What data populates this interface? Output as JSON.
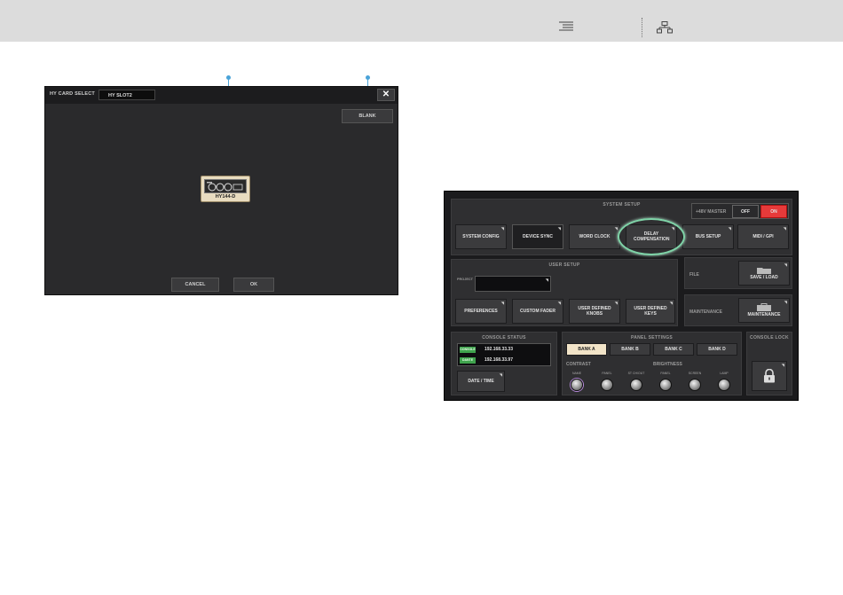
{
  "hy_dialog": {
    "title": "HY CARD SELECT",
    "slot_label": "HY SLOT2",
    "slot_prefix": "HY",
    "blank_button": "BLANK",
    "card_name": "HY144-D",
    "cancel_button": "CANCEL",
    "ok_button": "OK"
  },
  "system_setup": {
    "header": "SYSTEM SETUP",
    "phantom_master": "+48V MASTER",
    "off_label": "OFF",
    "on_label": "ON",
    "buttons": [
      "SYSTEM CONFIG",
      "DEVICE SYNC",
      "WORD CLOCK",
      "DELAY COMPENSATION",
      "BUS SETUP",
      "MIDI / GPI"
    ]
  },
  "user_setup": {
    "header": "USER SETUP",
    "project_label": "PROJECT",
    "buttons": [
      "PREFERENCES",
      "CUSTOM FADER",
      "USER DEFINED KNOBS",
      "USER DEFINED KEYS"
    ]
  },
  "file": {
    "label": "FILE",
    "button": "SAVE / LOAD"
  },
  "maintenance": {
    "label": "MAINTENANCE",
    "button": "MAINTENANCE"
  },
  "console_status": {
    "header": "CONSOLE STATUS",
    "rows": [
      {
        "tag": "CONSOLE",
        "ip": "192.168.33.33"
      },
      {
        "tag": "DANTE",
        "ip": "192.168.33.97"
      }
    ],
    "date_time": "DATE / TIME"
  },
  "panel_settings": {
    "header": "PANEL SETTINGS",
    "banks": [
      "BANK A",
      "BANK B",
      "BANK C",
      "BANK D"
    ],
    "contrast_label": "CONTRAST",
    "brightness_label": "BRIGHTNESS",
    "knob_labels": [
      "NAME",
      "PANEL",
      "ST CH/OUT",
      "PANEL",
      "SCREEN",
      "LAMP"
    ]
  },
  "console_lock": {
    "header": "CONSOLE LOCK"
  },
  "colors": {
    "on_red": "#e63a3a",
    "highlight": "#7fd4a8",
    "callout": "#4aa3d8",
    "bank_selected": "#f2e4c8"
  }
}
